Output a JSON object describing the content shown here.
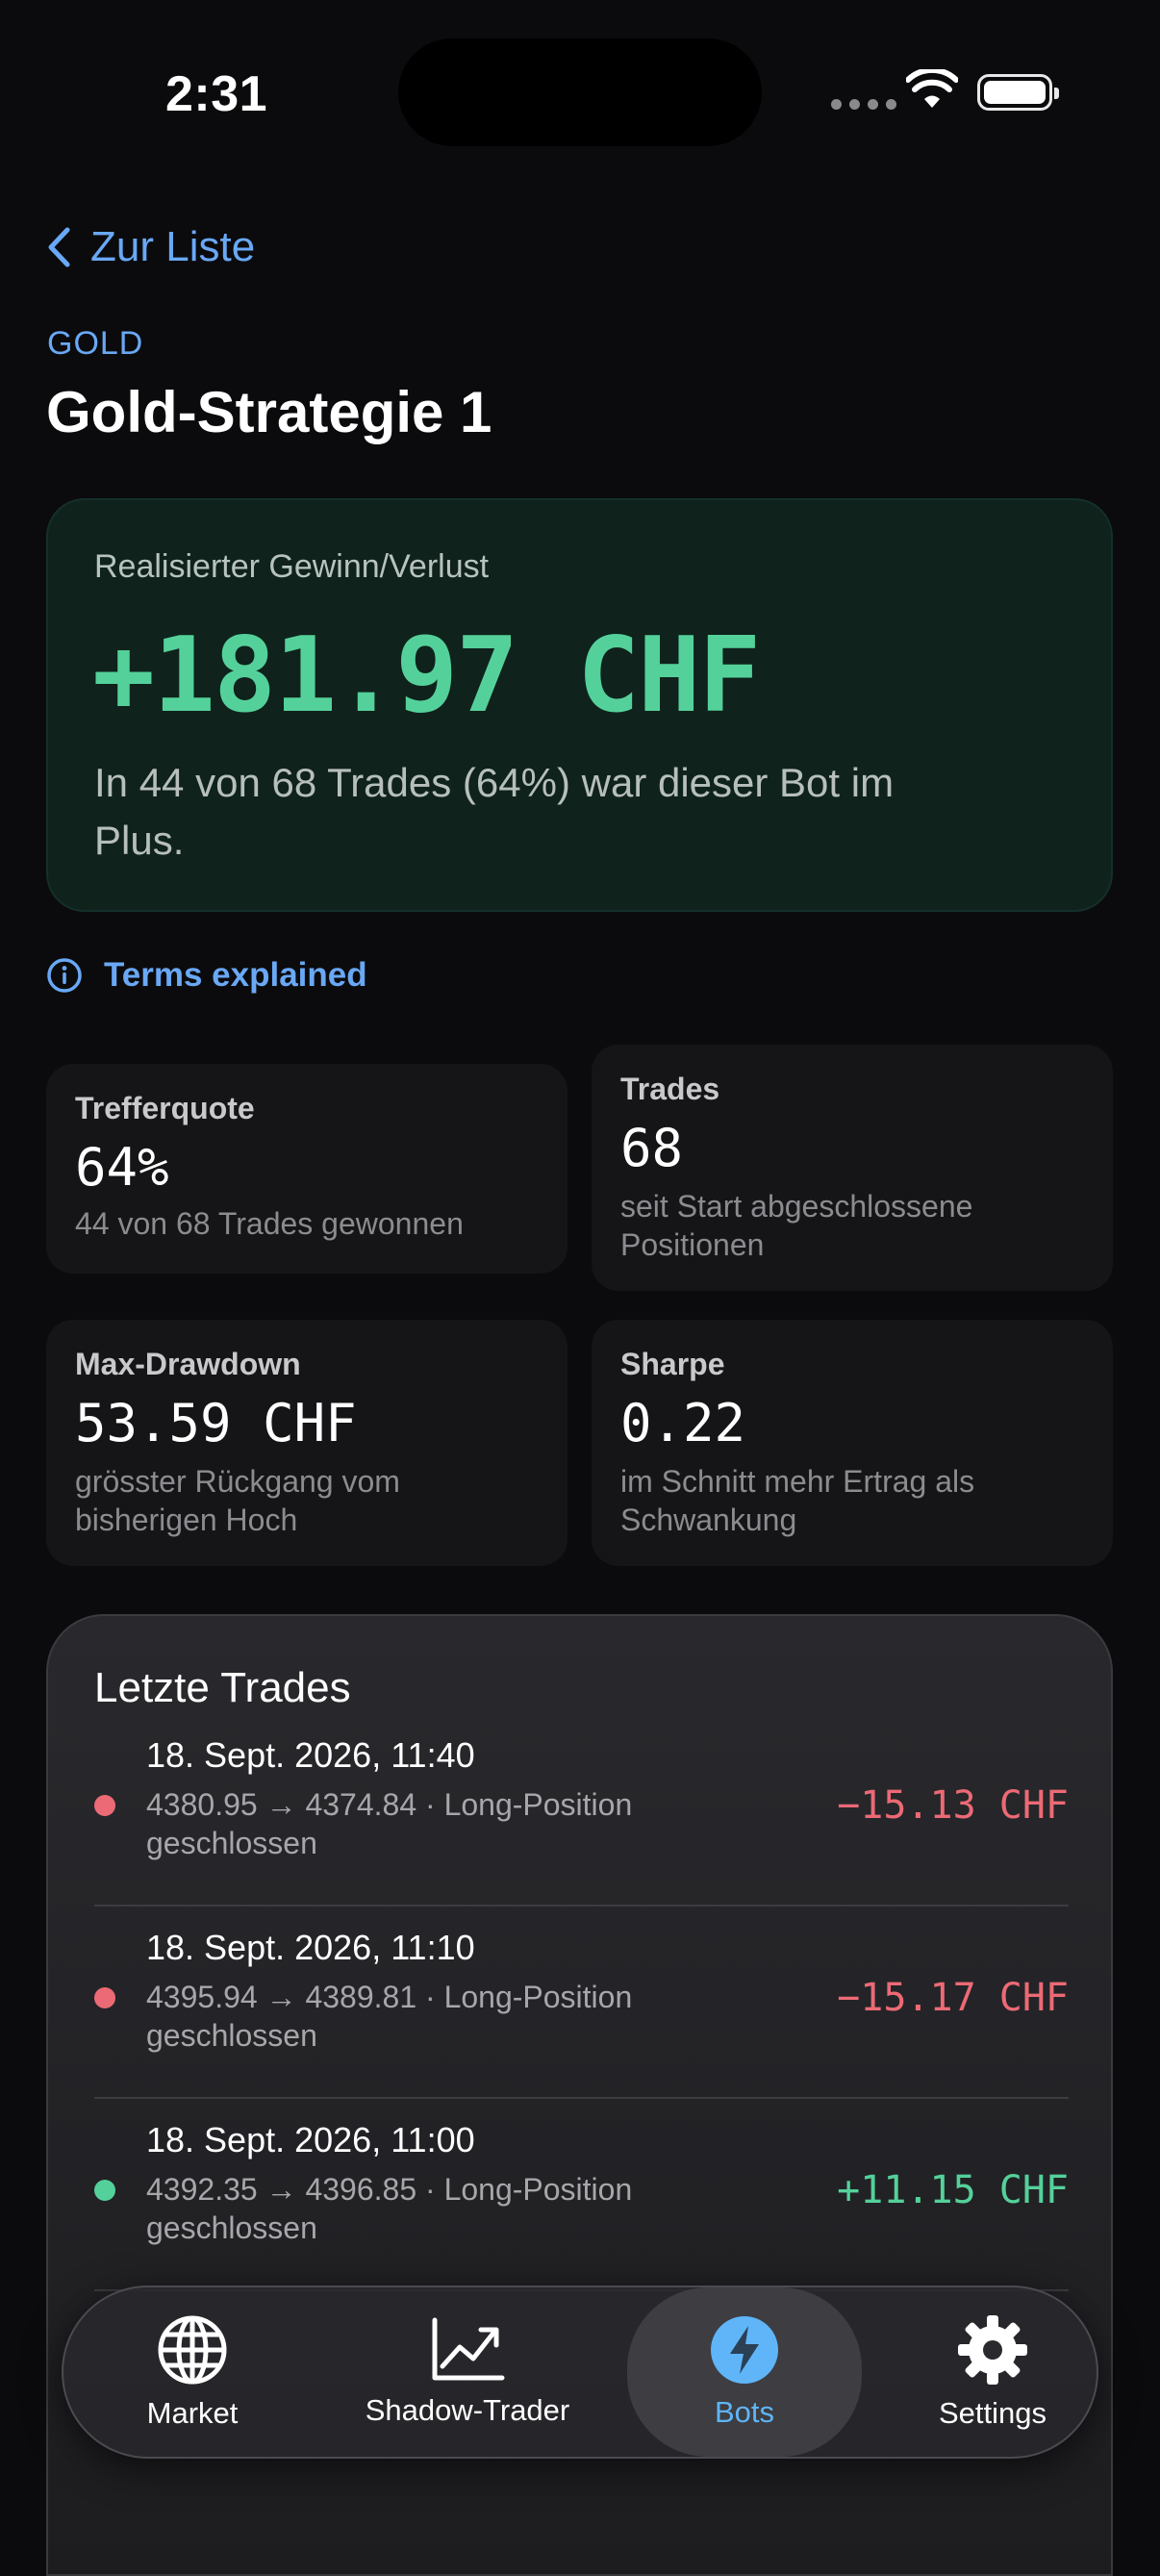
{
  "status": {
    "time": "2:31"
  },
  "nav": {
    "back_label": "Zur Liste"
  },
  "bot": {
    "category": "GOLD",
    "name": "Gold-Strategie 1"
  },
  "hero": {
    "label": "Realisierter Gewinn/Verlust",
    "value": "+181.97 CHF",
    "description": "In 44 von 68 Trades (64%) war dieser Bot im Plus."
  },
  "terms_link": "Terms explained",
  "stats": [
    {
      "label": "Trefferquote",
      "value": "64%",
      "sub": "44 von 68 Trades gewonnen"
    },
    {
      "label": "Trades",
      "value": "68",
      "sub": "seit Start abgeschlossene Positionen"
    },
    {
      "label": "Max-Drawdown",
      "value": "53.59 CHF",
      "sub": "grösster Rückgang vom bisherigen Hoch"
    },
    {
      "label": "Sharpe",
      "value": "0.22",
      "sub": "im Schnitt mehr Ertrag als Schwankung"
    }
  ],
  "trades": {
    "title": "Letzte Trades",
    "rows": [
      {
        "date": "18. Sept. 2026, 11:40",
        "desc": "4380.95 → 4374.84 · Long-Position geschlossen",
        "amount": "−15.13 CHF",
        "status": "loss"
      },
      {
        "date": "18. Sept. 2026, 11:10",
        "desc": "4395.94 → 4389.81 · Long-Position geschlossen",
        "amount": "−15.17 CHF",
        "status": "loss"
      },
      {
        "date": "18. Sept. 2026, 11:00",
        "desc": "4392.35 → 4396.85 · Long-Position geschlossen",
        "amount": "+11.15 CHF",
        "status": "win"
      }
    ]
  },
  "tabbar": {
    "items": [
      {
        "label": "Market",
        "icon": "globe-icon"
      },
      {
        "label": "Shadow-Trader",
        "icon": "chart-trend-icon"
      },
      {
        "label": "Bots",
        "icon": "bolt-icon"
      },
      {
        "label": "Settings",
        "icon": "gear-icon"
      }
    ]
  },
  "colors": {
    "accent": "#69a8f5",
    "positive": "#54d19a",
    "negative": "#ec6a75",
    "background": "#0b0b0d"
  }
}
